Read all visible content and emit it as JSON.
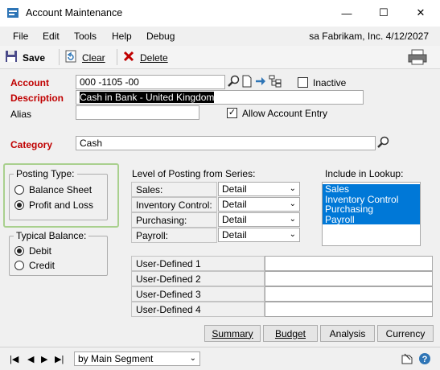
{
  "window": {
    "title": "Account Maintenance",
    "minimize": "—",
    "maximize": "☐",
    "close": "✕"
  },
  "menu": {
    "items": [
      "File",
      "Edit",
      "Tools",
      "Help",
      "Debug"
    ],
    "company_status": "sa  Fabrikam, Inc.  4/12/2027"
  },
  "toolbar": {
    "save": "Save",
    "clear": "Clear",
    "delete": "Delete"
  },
  "form": {
    "account_label": "Account",
    "account_value": "000 -1105 -00",
    "inactive_label": "Inactive",
    "description_label": "Description",
    "description_value": "Cash in Bank - United Kingdom",
    "alias_label": "Alias",
    "alias_value": "",
    "allow_entry_label": "Allow Account Entry",
    "category_label": "Category",
    "category_value": "Cash"
  },
  "posting_type": {
    "label": "Posting Type:",
    "options": [
      "Balance Sheet",
      "Profit and Loss"
    ],
    "selected": "Profit and Loss"
  },
  "typical_balance": {
    "label": "Typical Balance:",
    "options": [
      "Debit",
      "Credit"
    ],
    "selected": "Debit"
  },
  "level_posting": {
    "label": "Level of Posting from Series:",
    "rows": [
      {
        "series": "Sales:",
        "value": "Detail"
      },
      {
        "series": "Inventory Control:",
        "value": "Detail"
      },
      {
        "series": "Purchasing:",
        "value": "Detail"
      },
      {
        "series": "Payroll:",
        "value": "Detail"
      }
    ]
  },
  "lookup": {
    "label": "Include in Lookup:",
    "items": [
      "Sales",
      "Inventory Control",
      "Purchasing",
      "Payroll"
    ]
  },
  "user_defined": {
    "labels": [
      "User-Defined 1",
      "User-Defined 2",
      "User-Defined 3",
      "User-Defined 4"
    ],
    "values": [
      "",
      "",
      "",
      ""
    ]
  },
  "buttons": {
    "summary": "Summary",
    "budget": "Budget",
    "analysis": "Analysis",
    "currency": "Currency"
  },
  "statusbar": {
    "sort": "by Main Segment"
  },
  "colors": {
    "required_label": "#c00000",
    "selection": "#0078d7",
    "highlight_border": "#a9d08e"
  }
}
